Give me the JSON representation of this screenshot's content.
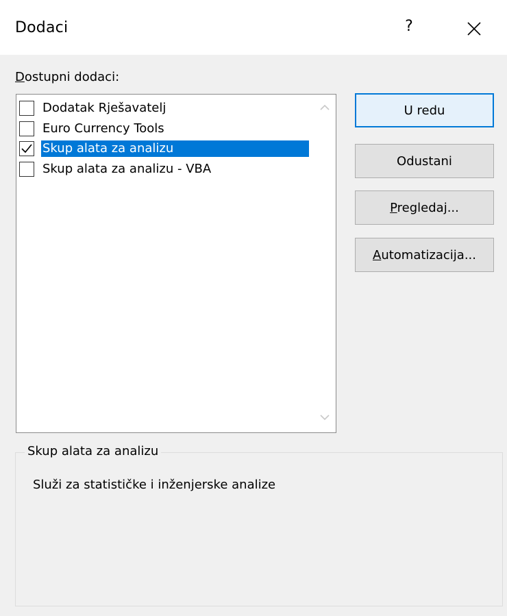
{
  "window": {
    "title": "Dodaci",
    "help_glyph": "?",
    "close_icon": "close-icon"
  },
  "addins": {
    "label_first": "D",
    "label_rest": "ostupni dodaci:",
    "items": [
      {
        "label": "Dodatak Rješavatelj",
        "checked": false,
        "selected": false
      },
      {
        "label": "Euro Currency Tools",
        "checked": false,
        "selected": false
      },
      {
        "label": "Skup alata za analizu",
        "checked": true,
        "selected": true
      },
      {
        "label": "Skup alata za analizu - VBA",
        "checked": false,
        "selected": false
      }
    ]
  },
  "buttons": {
    "ok": "U redu",
    "cancel": "Odustani",
    "browse_first": "P",
    "browse_rest": "regledaj...",
    "automation_first": "A",
    "automation_rest": "utomatizacija..."
  },
  "details": {
    "title": "Skup alata za analizu",
    "description": "Služi za statističke i inženjerske analize"
  },
  "colors": {
    "selection": "#0078d7",
    "dialog_bg": "#f0f0f0",
    "button_bg": "#e1e1e1"
  }
}
